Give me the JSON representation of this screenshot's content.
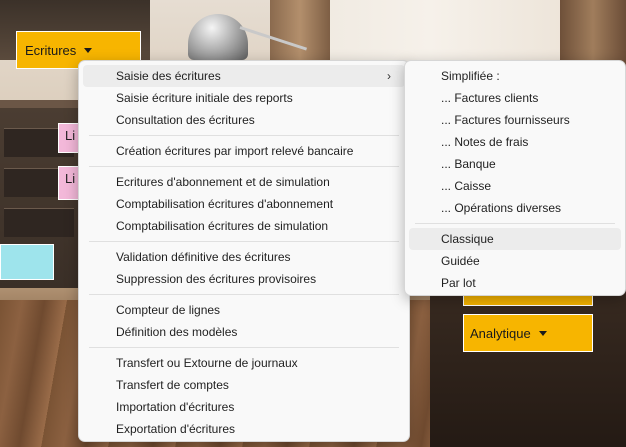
{
  "app": {
    "ecritures_button": "Ecritures",
    "analytique_button": "Analytique",
    "pink_tile_1": "Li",
    "pink_tile_2": "Li"
  },
  "colors": {
    "button_yellow": "#f7b500",
    "tile_pink": "#f3b8d9",
    "tile_cyan": "#9ee4ec"
  },
  "main_menu": {
    "groups": [
      [
        {
          "label": "Saisie des écritures",
          "submenu": true,
          "highlighted": true
        },
        {
          "label": "Saisie écriture initiale des reports"
        },
        {
          "label": "Consultation des écritures"
        }
      ],
      [
        {
          "label": "Création écritures par import relevé bancaire"
        }
      ],
      [
        {
          "label": "Ecritures d'abonnement et de simulation"
        },
        {
          "label": "Comptabilisation écritures d'abonnement"
        },
        {
          "label": "Comptabilisation écritures de simulation"
        }
      ],
      [
        {
          "label": "Validation définitive des écritures"
        },
        {
          "label": "Suppression des écritures provisoires"
        }
      ],
      [
        {
          "label": "Compteur de lignes"
        },
        {
          "label": "Définition des modèles"
        }
      ],
      [
        {
          "label": "Transfert ou Extourne de journaux"
        },
        {
          "label": "Transfert de comptes"
        },
        {
          "label": "Importation d'écritures"
        },
        {
          "label": "Exportation d'écritures"
        }
      ]
    ]
  },
  "sub_menu": {
    "groups": [
      [
        {
          "label": "Simplifiée :"
        },
        {
          "label": "... Factures clients"
        },
        {
          "label": "... Factures fournisseurs"
        },
        {
          "label": "... Notes de frais"
        },
        {
          "label": "... Banque"
        },
        {
          "label": "... Caisse"
        },
        {
          "label": "... Opérations diverses"
        }
      ],
      [
        {
          "label": "Classique",
          "highlighted": true
        },
        {
          "label": "Guidée"
        },
        {
          "label": "Par lot"
        }
      ]
    ]
  }
}
